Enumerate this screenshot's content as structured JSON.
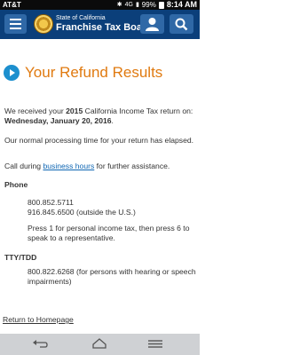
{
  "status_bar": {
    "carrier": "AT&T",
    "network": "4G",
    "battery": "99%",
    "time": "8:14 AM"
  },
  "header": {
    "brand_line1": "State of California",
    "brand_line2": "Franchise Tax Board",
    "icons": [
      "menu-icon",
      "state-seal-logo",
      "user-icon",
      "search-icon"
    ],
    "colors": {
      "bar": "#0b3f7a",
      "button": "#2f68a6"
    }
  },
  "page": {
    "title": "Your Refund Results",
    "title_color": "#e07a10",
    "received_prefix": "We received your ",
    "received_year": "2015",
    "received_mid": " California Income Tax return on: ",
    "received_date": "Wednesday, January 20, 2016",
    "received_suffix": ".",
    "processing": "Our normal processing time for your return has elapsed.",
    "call_prefix": "Call during ",
    "call_link": "business hours",
    "call_suffix": " for further assistance.",
    "phone_heading": "Phone",
    "phone1": "800.852.5711",
    "phone2": "916.845.6500 (outside the U.S.)",
    "press": "Press 1 for personal income tax, then press 6 to speak to a representative.",
    "tty_heading": "TTY/TDD",
    "tty": "800.822.6268 (for persons with hearing or speech impairments)",
    "return_link": "Return to Homepage"
  },
  "nav_bar": {
    "icons": [
      "back-icon",
      "home-icon",
      "recent-apps-icon"
    ]
  }
}
